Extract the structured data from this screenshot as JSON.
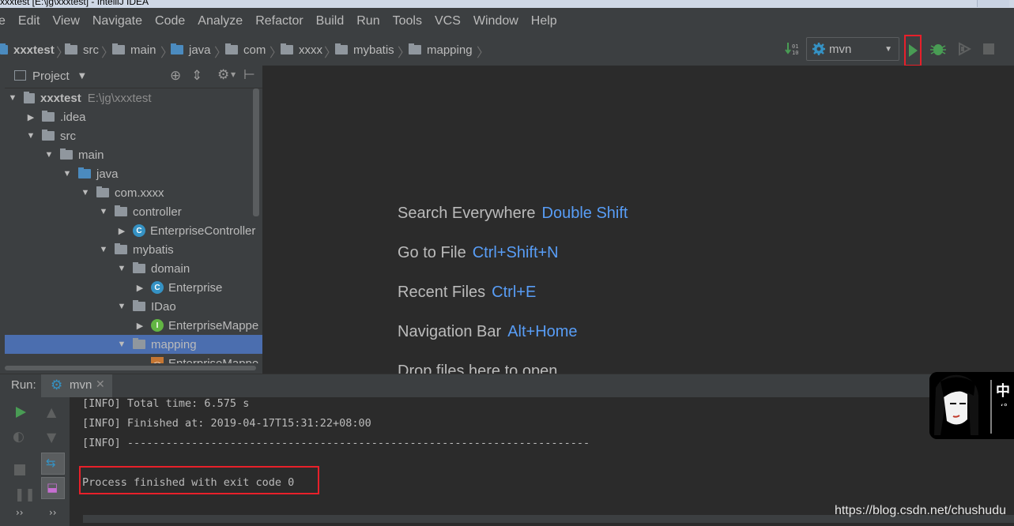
{
  "window": {
    "title": "xxxtest [E:\\jg\\xxxtest] - IntelliJ IDEA"
  },
  "menu": [
    "e",
    "Edit",
    "View",
    "Navigate",
    "Code",
    "Analyze",
    "Refactor",
    "Build",
    "Run",
    "Tools",
    "VCS",
    "Window",
    "Help"
  ],
  "breadcrumb": [
    "xxxtest",
    "src",
    "main",
    "java",
    "com",
    "xxxx",
    "mybatis",
    "mapping"
  ],
  "run_config": {
    "name": "mvn"
  },
  "project_panel": {
    "title": "Project"
  },
  "tree": {
    "root": {
      "label": "xxxtest",
      "path": "E:\\jg\\xxxtest"
    },
    "items": [
      ".idea",
      "src",
      "main",
      "java",
      "com.xxxx",
      "controller",
      "EnterpriseController",
      "mybatis",
      "domain",
      "Enterprise",
      "IDao",
      "EnterpriseMappe",
      "mapping",
      "EnterpriseMappe"
    ]
  },
  "editor_hints": [
    {
      "label": "Search Everywhere",
      "key": "Double Shift"
    },
    {
      "label": "Go to File",
      "key": "Ctrl+Shift+N"
    },
    {
      "label": "Recent Files",
      "key": "Ctrl+E"
    },
    {
      "label": "Navigation Bar",
      "key": "Alt+Home"
    },
    {
      "label": "Drop files here to open",
      "key": ""
    }
  ],
  "run_panel": {
    "label": "Run:",
    "tab": "mvn",
    "console": [
      "[INFO] Total time: 6.575 s",
      "[INFO] Finished at: 2019-04-17T15:31:22+08:00",
      "[INFO] ------------------------------------------------------------------------",
      "Process finished with exit code 0"
    ]
  },
  "watermark": "https://blog.csdn.net/chushudu",
  "avatar_text": "中",
  "chevrons": "››",
  "colors": {
    "accent_link": "#589df6",
    "highlight_box": "#e8202a",
    "selection": "#4b6eaf",
    "run_green": "#499c54"
  }
}
